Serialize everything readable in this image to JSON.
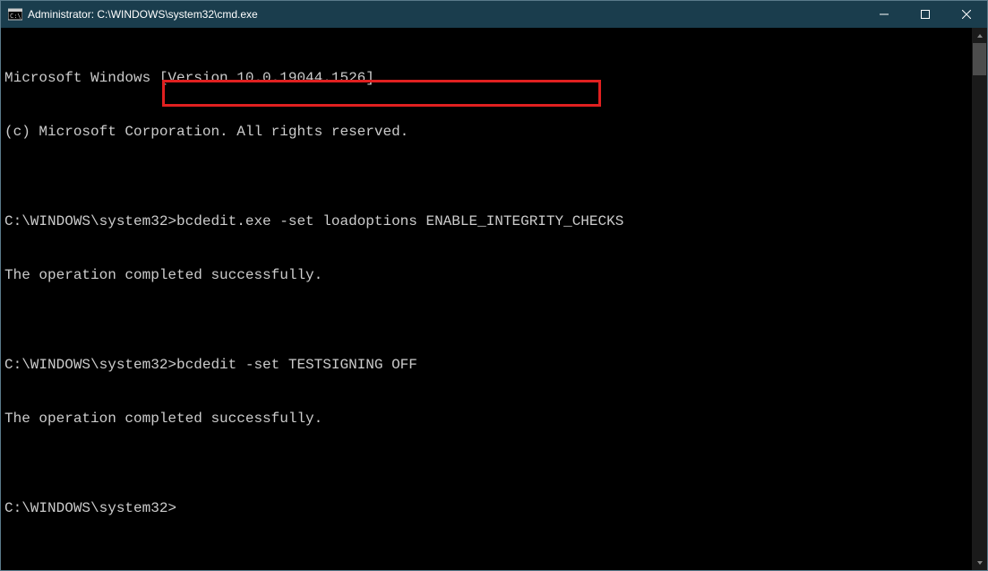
{
  "titlebar": {
    "title": "Administrator: C:\\WINDOWS\\system32\\cmd.exe"
  },
  "terminal": {
    "lines": [
      "Microsoft Windows [Version 10.0.19044.1526]",
      "(c) Microsoft Corporation. All rights reserved.",
      "",
      "C:\\WINDOWS\\system32>bcdedit.exe -set loadoptions ENABLE_INTEGRITY_CHECKS",
      "The operation completed successfully.",
      "",
      "C:\\WINDOWS\\system32>bcdedit -set TESTSIGNING OFF",
      "The operation completed successfully.",
      "",
      "C:\\WINDOWS\\system32>"
    ]
  },
  "annotation": {
    "highlighted_command": "bcdedit.exe -set loadoptions ENABLE_INTEGRITY_CHECKS"
  }
}
